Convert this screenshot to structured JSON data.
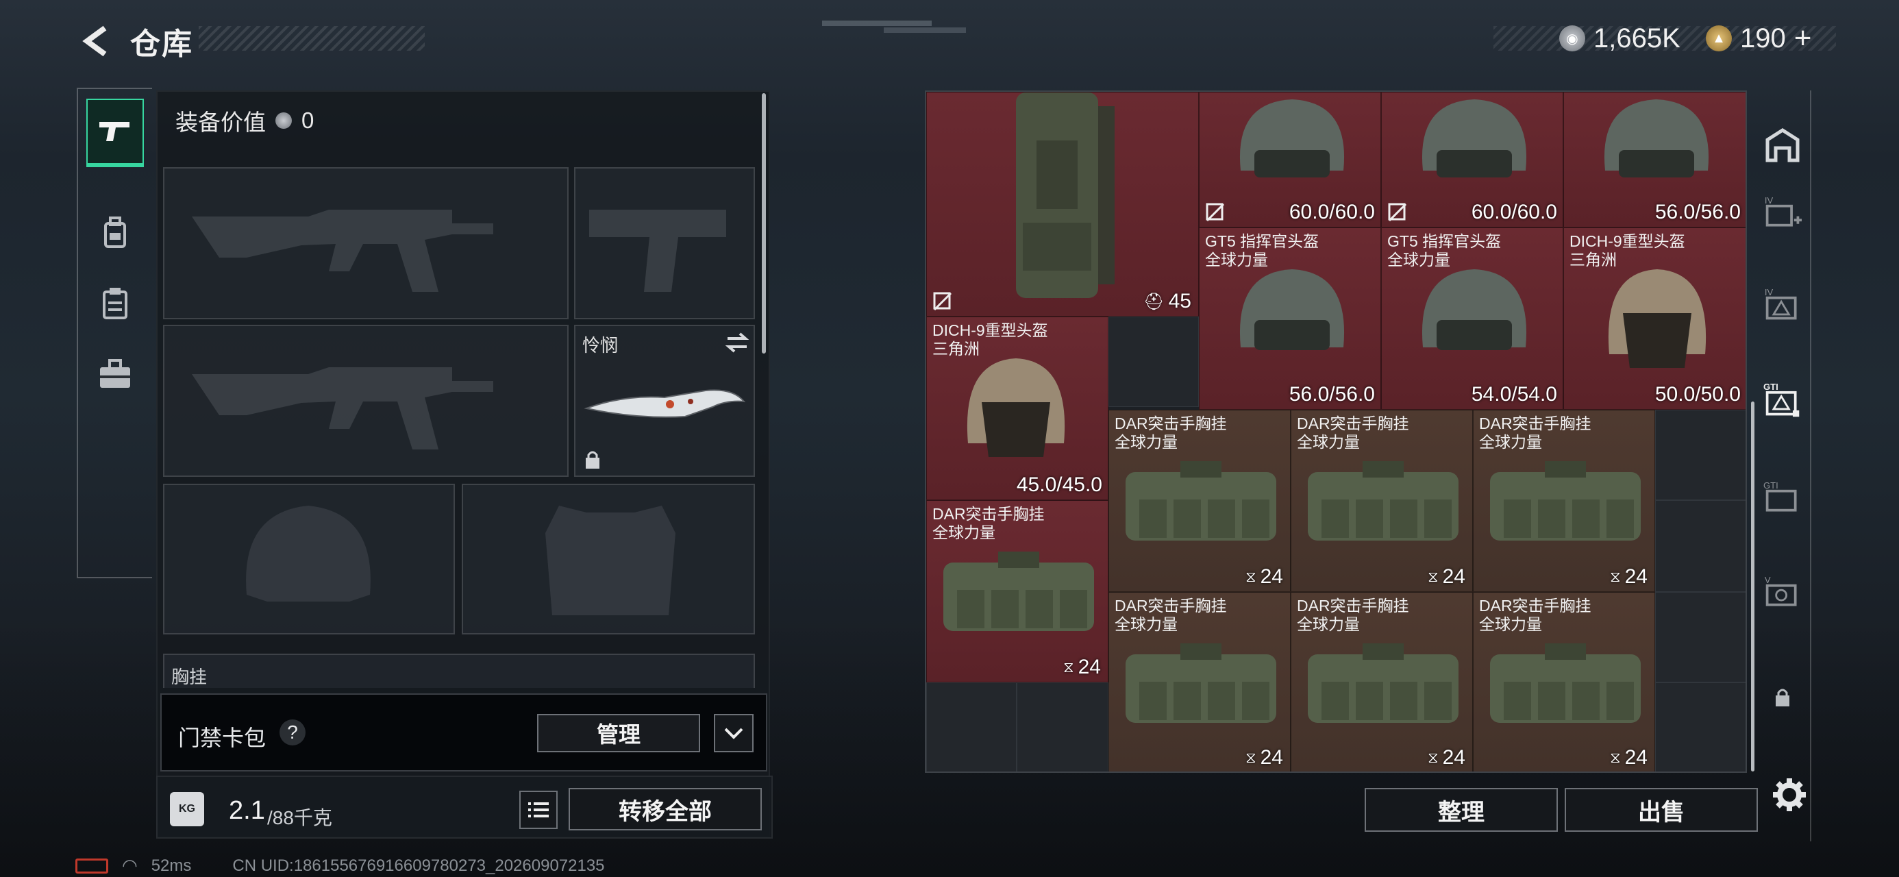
{
  "header": {
    "title": "仓库",
    "currencies": [
      {
        "icon": "silver-coin-icon",
        "value": "1,665K"
      },
      {
        "icon": "gold-triangle-coin-icon",
        "value": "190"
      }
    ],
    "add_label": "+"
  },
  "left_nav": [
    {
      "icon": "pistol-icon",
      "active": true
    },
    {
      "icon": "backpack-icon",
      "active": false
    },
    {
      "icon": "clipboard-icon",
      "active": false
    },
    {
      "icon": "briefcase-icon",
      "active": false
    }
  ],
  "loadout": {
    "equipment_value_label": "装备价值",
    "equipment_value": "0",
    "melee_slot_name": "怜悯",
    "chest_rig_label": "胸挂",
    "help_mark": "?"
  },
  "access_card": {
    "label": "门禁卡包",
    "help": "?",
    "manage_label": "管理"
  },
  "weight": {
    "current": "2.1",
    "max": "/88千克",
    "kg_icon_text": "KG",
    "transfer_all_label": "转移全部"
  },
  "stash_items": [
    {
      "id": "backpack",
      "count": "45"
    },
    {
      "id": "helmet-1",
      "value": "60.0/60.0"
    },
    {
      "id": "helmet-2",
      "value": "60.0/60.0"
    },
    {
      "id": "helmet-3",
      "value": "56.0/56.0"
    },
    {
      "id": "helmet-4",
      "name": "GT5 指挥官头盔",
      "sub": "全球力量",
      "value": "56.0/56.0"
    },
    {
      "id": "helmet-5",
      "name": "GT5 指挥官头盔",
      "sub": "全球力量",
      "value": "54.0/54.0"
    },
    {
      "id": "helmet-6",
      "name": "DICH-9重型头盔",
      "sub": "三角洲",
      "value": "50.0/50.0"
    },
    {
      "id": "helmet-7",
      "name": "DICH-9重型头盔",
      "sub": "三角洲",
      "value": "45.0/45.0"
    },
    {
      "id": "rig-1",
      "name": "DAR突击手胸挂",
      "sub": "全球力量",
      "count": "24"
    },
    {
      "id": "rig-2",
      "name": "DAR突击手胸挂",
      "sub": "全球力量",
      "count": "24"
    },
    {
      "id": "rig-3",
      "name": "DAR突击手胸挂",
      "sub": "全球力量",
      "count": "24"
    },
    {
      "id": "rig-4",
      "name": "DAR突击手胸挂",
      "sub": "全球力量",
      "count": "24"
    },
    {
      "id": "rig-5",
      "name": "DAR突击手胸挂",
      "sub": "全球力量",
      "count": "24"
    },
    {
      "id": "rig-6",
      "name": "DAR突击手胸挂",
      "sub": "全球力量",
      "count": "24"
    },
    {
      "id": "rig-7",
      "name": "DAR突击手胸挂",
      "sub": "全球力量",
      "count": "24"
    }
  ],
  "right_rail": [
    {
      "icon": "stash-home-icon"
    },
    {
      "icon": "storage-iv-plus-icon",
      "label": "IV"
    },
    {
      "icon": "storage-iv-icon",
      "label": "IV"
    },
    {
      "icon": "storage-gti-selected-icon",
      "label": "GTI"
    },
    {
      "icon": "storage-gti-icon",
      "label": "GTI"
    },
    {
      "icon": "storage-v-icon",
      "label": "V"
    },
    {
      "icon": "lock-icon"
    }
  ],
  "actions": {
    "sort_label": "整理",
    "sell_label": "出售"
  },
  "footer": {
    "ping": "52ms",
    "uid": "CN UID:1861556769166097802​73_202609072135"
  },
  "colors": {
    "accent": "#37d6a0",
    "item_red": "#6a2a31",
    "item_brown": "#4f3a30"
  }
}
